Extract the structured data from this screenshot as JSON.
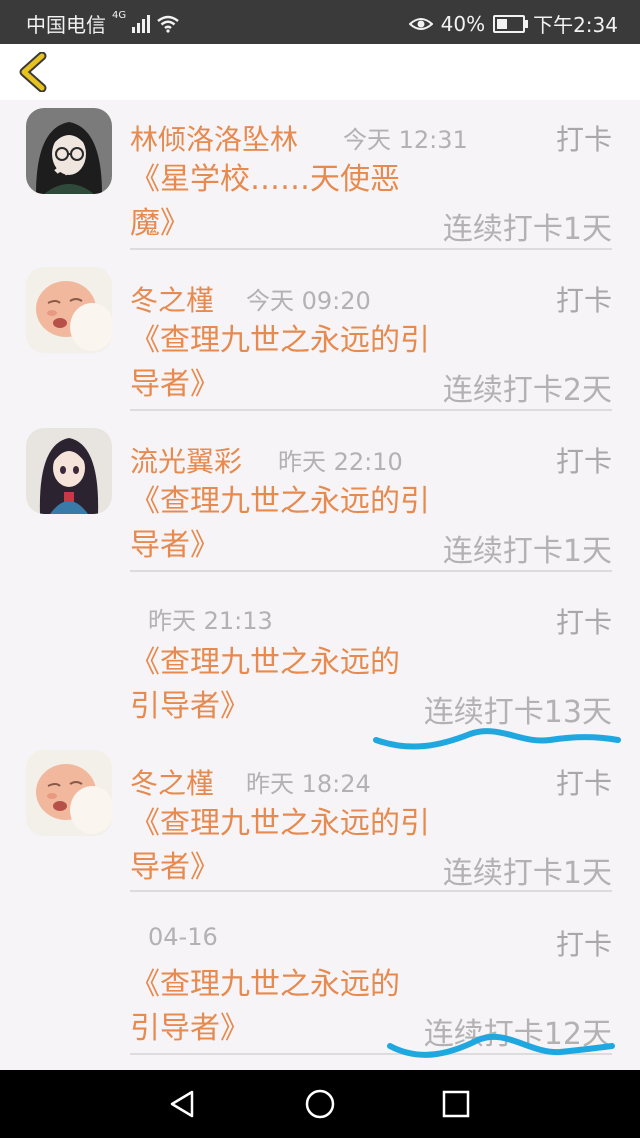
{
  "status_bar": {
    "carrier": "中国电信",
    "network_type": "4G",
    "battery_percent": "40%",
    "time": "下午2:34"
  },
  "app_bar": {
    "back_icon": "chevron-left-icon",
    "accent_color": "#e8c21e"
  },
  "items": [
    {
      "user": "林倾洛洛坠林",
      "time": "今天 12:31",
      "action": "打卡",
      "title": "《星学校……天使恶魔》",
      "streak": "连续打卡1天",
      "avatar": "girl-with-glasses-avatar"
    },
    {
      "user": "冬之槿",
      "time": "今天 09:20",
      "action": "打卡",
      "title": "《查理九世之永远的引导者》",
      "streak": "连续打卡2天",
      "avatar": "baby-avatar"
    },
    {
      "user": "流光翼彩",
      "time": "昨天 22:10",
      "action": "打卡",
      "title": "《查理九世之永远的引导者》",
      "streak": "连续打卡1天",
      "avatar": "anime-girl-avatar"
    },
    {
      "user": "",
      "time": "昨天 21:13",
      "action": "打卡",
      "title": "《查理九世之永远的引导者》",
      "streak": "连续打卡13天",
      "avatar": ""
    },
    {
      "user": "冬之槿",
      "time": "昨天 18:24",
      "action": "打卡",
      "title": "《查理九世之永远的引导者》",
      "streak": "连续打卡1天",
      "avatar": "baby-avatar"
    },
    {
      "user": "",
      "time": "04-16",
      "action": "打卡",
      "title": "《查理九世之永远的引导者》",
      "streak": "连续打卡12天",
      "avatar": ""
    }
  ],
  "colors": {
    "accent_orange": "#e68a4f",
    "muted_gray": "#b2b2b2",
    "annotation_blue": "#1fa7e0"
  }
}
